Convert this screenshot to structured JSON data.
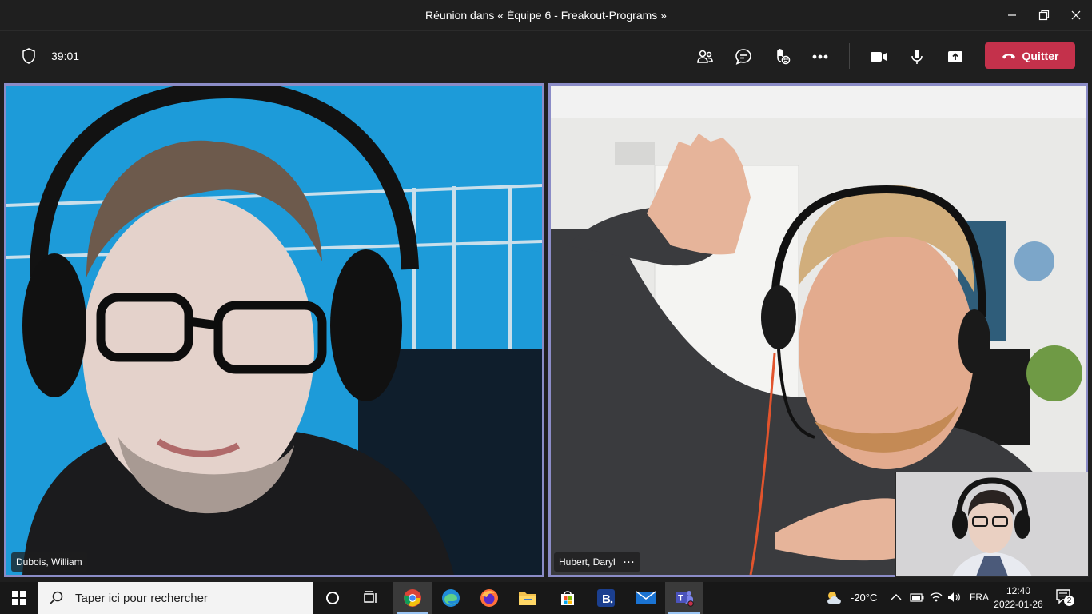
{
  "window": {
    "title": "Réunion dans « Équipe 6 - Freakout-Programs »"
  },
  "meeting": {
    "timer": "39:01",
    "leave_label": "Quitter",
    "leave_color": "#c4314b",
    "toolbar_icons": [
      "participants-icon",
      "chat-icon",
      "raise-hand-icon",
      "more-options-icon",
      "camera-icon",
      "microphone-icon",
      "share-screen-icon"
    ]
  },
  "participants": [
    {
      "name": "Dubois, William"
    },
    {
      "name": "Hubert, Daryl",
      "more": "···"
    }
  ],
  "accent_color": "#8b8cc7",
  "taskbar": {
    "search_placeholder": "Taper ici pour rechercher",
    "apps": [
      "task-view-icon",
      "chrome-icon",
      "edge-icon",
      "firefox-icon",
      "file-explorer-icon",
      "microsoft-store-icon",
      "b-app-icon",
      "mail-icon",
      "teams-icon"
    ],
    "weather": "-20°C",
    "language": "FRA",
    "time": "12:40",
    "date": "2022-01-26",
    "notification_count": "2"
  }
}
